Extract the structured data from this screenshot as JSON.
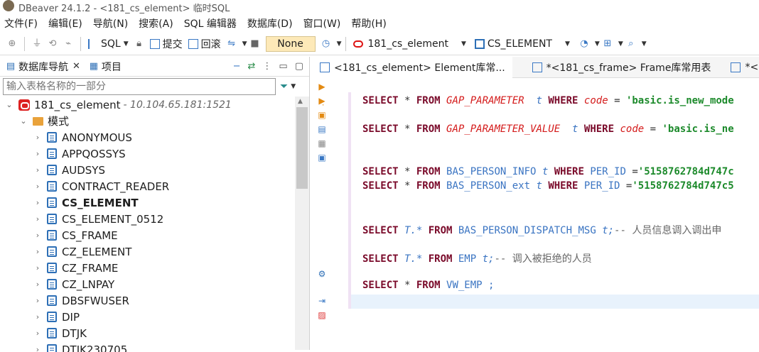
{
  "window": {
    "title": "DBeaver 24.1.2 - <181_cs_element> 临时SQL"
  },
  "menu": [
    "文件(F)",
    "编辑(E)",
    "导航(N)",
    "搜索(A)",
    "SQL 编辑器",
    "数据库(D)",
    "窗口(W)",
    "帮助(H)"
  ],
  "toolbar": {
    "sql_label": "SQL",
    "commit_label": "提交",
    "rollback_label": "回滚",
    "transaction_mode": "None",
    "connection": "181_cs_element",
    "schema": "CS_ELEMENT"
  },
  "navigator": {
    "tab_db": "数据库导航",
    "tab_project": "项目",
    "filter_placeholder": "输入表格名称的一部分",
    "connection": {
      "name": "181_cs_element",
      "host": "- 10.104.65.181:1521"
    },
    "schema_folder": "模式",
    "schemas": [
      "ANONYMOUS",
      "APPQOSSYS",
      "AUDSYS",
      "CONTRACT_READER",
      "CS_ELEMENT",
      "CS_ELEMENT_0512",
      "CS_FRAME",
      "CZ_ELEMENT",
      "CZ_FRAME",
      "CZ_LNPAY",
      "DBSFWUSER",
      "DIP",
      "DTJK",
      "DTJK230705"
    ]
  },
  "editor": {
    "tabs": [
      "<181_cs_element> Element库常...",
      "*<181_cs_frame> Frame库常用表",
      "*<"
    ],
    "lines": [
      {
        "a": "SELECT",
        "b": " * ",
        "c": "FROM",
        "d": " GAP_PARAMETER",
        "e": "  t",
        "f": " WHERE ",
        "g": "code",
        "h": " = ",
        "i": "'basic.is_new_mode"
      },
      {
        "a": "SELECT",
        "b": " * ",
        "c": "FROM",
        "d": " GAP_PARAMETER_VALUE",
        "e": "  t",
        "f": " WHERE ",
        "g": "code",
        "h": " = ",
        "i": "'basic.is_ne"
      },
      {
        "a": "SELECT",
        "b": " * ",
        "c": "FROM",
        "d": " BAS_PERSON_INFO",
        "e": " t",
        "f": " WHERE ",
        "g": "PER_ID",
        "h": " =",
        "i": "'5158762784d747c"
      },
      {
        "a": "SELECT",
        "b": " * ",
        "c": "FROM",
        "d": " BAS_PERSON_ext",
        "e": " t",
        "f": " WHERE ",
        "g": "PER_ID",
        "h": " =",
        "i": "'5158762784d747c5"
      },
      {
        "a": "SELECT",
        "b": " T.* ",
        "c": "FROM",
        "d": " BAS_PERSON_DISPATCH_MSG",
        "e": " t;",
        "cmt": "-- 人员信息调入调出申"
      },
      {
        "a": "SELECT",
        "b": " T.* ",
        "c": "FROM",
        "d": " EMP",
        "e": " t;",
        "cmt": "-- 调入被拒绝的人员"
      },
      {
        "a": "SELECT",
        "b": " * ",
        "c": "FROM",
        "d": " VW_EMP ;"
      }
    ]
  }
}
